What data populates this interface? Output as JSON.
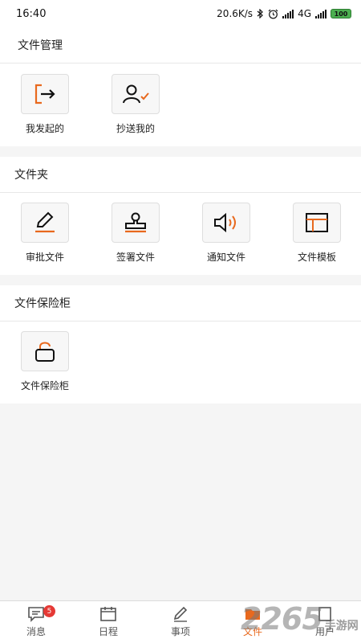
{
  "status": {
    "time": "16:40",
    "speed": "20.6K/s",
    "network": "4G",
    "battery": "100"
  },
  "sections": [
    {
      "title": "文件管理",
      "items": [
        {
          "label": "我发起的",
          "icon": "exit-arrow-icon"
        },
        {
          "label": "抄送我的",
          "icon": "user-check-icon"
        }
      ]
    },
    {
      "title": "文件夹",
      "items": [
        {
          "label": "审批文件",
          "icon": "pencil-icon"
        },
        {
          "label": "签署文件",
          "icon": "stamp-icon"
        },
        {
          "label": "通知文件",
          "icon": "speaker-icon"
        },
        {
          "label": "文件模板",
          "icon": "template-icon"
        }
      ]
    },
    {
      "title": "文件保险柜",
      "items": [
        {
          "label": "文件保险柜",
          "icon": "unlock-icon"
        }
      ]
    }
  ],
  "tabs": [
    {
      "label": "消息",
      "icon": "message-icon",
      "badge": "5"
    },
    {
      "label": "日程",
      "icon": "calendar-icon"
    },
    {
      "label": "事项",
      "icon": "edit-icon"
    },
    {
      "label": "文件",
      "icon": "file-folder-icon",
      "active": true
    },
    {
      "label": "用户",
      "icon": "user-icon"
    }
  ],
  "watermark": {
    "number": "2265",
    "text": "手游网"
  },
  "colors": {
    "accent": "#e8691e",
    "ink": "#111111"
  }
}
